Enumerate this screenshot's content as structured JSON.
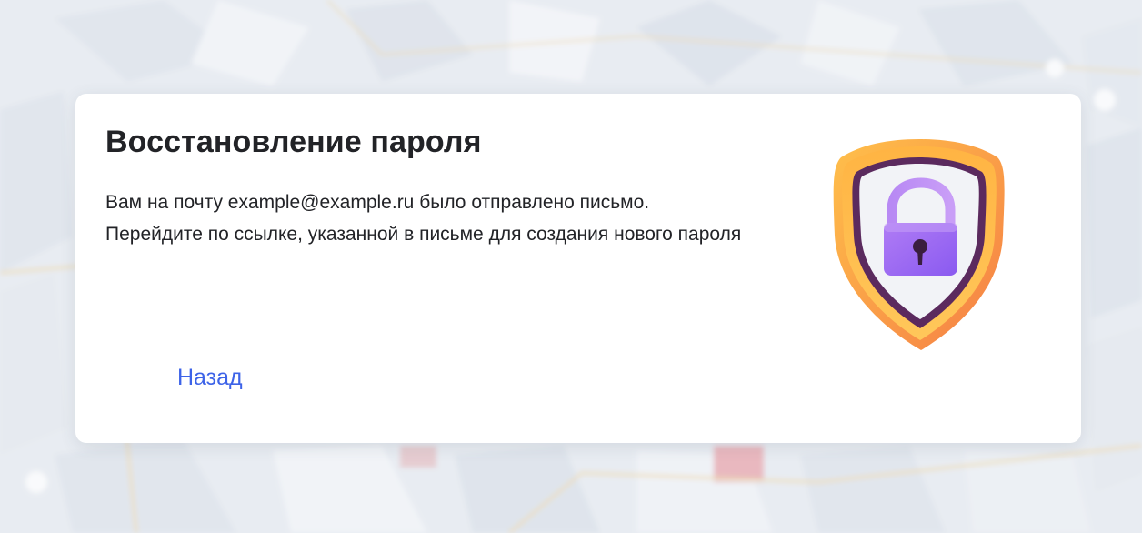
{
  "dialog": {
    "title": "Восстановление пароля",
    "message": "Вам на почту example@example.ru было отправлено письмо. Перейдите по ссылке, указанной в письме для создания нового пароля",
    "back_label": "Назад"
  },
  "icons": {
    "illustration": "shield-lock-icon"
  },
  "colors": {
    "link": "#3d63e8",
    "title": "#222327",
    "shield_outer": "#f9a03f",
    "shield_inner": "#f3f4f8",
    "lock": "#9b6bf2"
  }
}
